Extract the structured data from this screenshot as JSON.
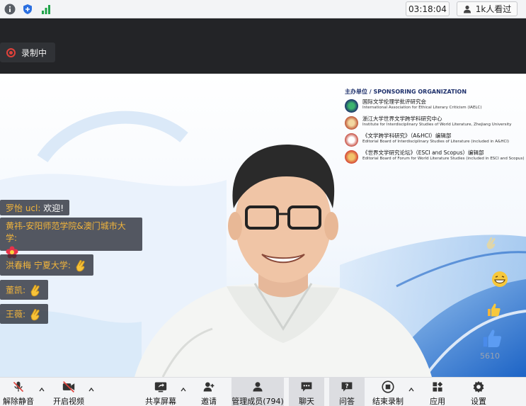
{
  "topbar": {
    "icons": [
      "info-icon",
      "shield-icon",
      "signal-icon"
    ],
    "timer": "03:18:04",
    "viewers": "1k人看过"
  },
  "recording": {
    "label": "录制中",
    "color": "#e0413a"
  },
  "sponsors": {
    "title": "主办单位 / SPONSORING ORGANIZATION",
    "items": [
      {
        "name": "国际文学伦理学批评研究会",
        "sub": "International Association for Ethical Literary Criticism (IAELC)"
      },
      {
        "name": "浙江大学世界文学跨学科研究中心",
        "sub": "Institute for Interdisciplinary Studies of World Literature, Zhejiang University"
      },
      {
        "name": "《文学跨学科研究》（A&HCI）编辑部",
        "sub": "Editorial Board of Interdisciplinary Studies of Literature (included in A&HCI)"
      },
      {
        "name": "《世界文学研究论坛》（ESCI and Scopus）编辑部",
        "sub": "Editorial Board of Forum for World Literature Studies (included in ESCI and Scopus)"
      }
    ]
  },
  "chat": [
    {
      "name": "罗怡 ucl:",
      "text": "欢迎!",
      "emoji": ""
    },
    {
      "name": "黄祎-安阳师范学院&澳门城市大学:",
      "text": "",
      "emoji": "flower"
    },
    {
      "name": "洪春梅 宁夏大学:",
      "text": "",
      "emoji": "clap"
    },
    {
      "name": "董凯:",
      "text": "",
      "emoji": "clap"
    },
    {
      "name": "王薇:",
      "text": "",
      "emoji": "clap"
    }
  ],
  "reactions": {
    "like_count": "5610",
    "icons": [
      "clap-icon",
      "grin-icon",
      "thumbs-up-icon",
      "like-button-icon"
    ]
  },
  "toolbar": {
    "unmute": "解除静音",
    "start_video": "开启视频",
    "share_screen": "共享屏幕",
    "invite": "邀请",
    "manage_members": "管理成员(794)",
    "chat": "聊天",
    "qa": "问答",
    "end_recording": "结束录制",
    "apps": "应用",
    "settings": "设置"
  },
  "colors": {
    "accent_orange": "#f2b53c",
    "toolbar_bg": "#f3f4f6",
    "dark_bg": "#232427"
  }
}
